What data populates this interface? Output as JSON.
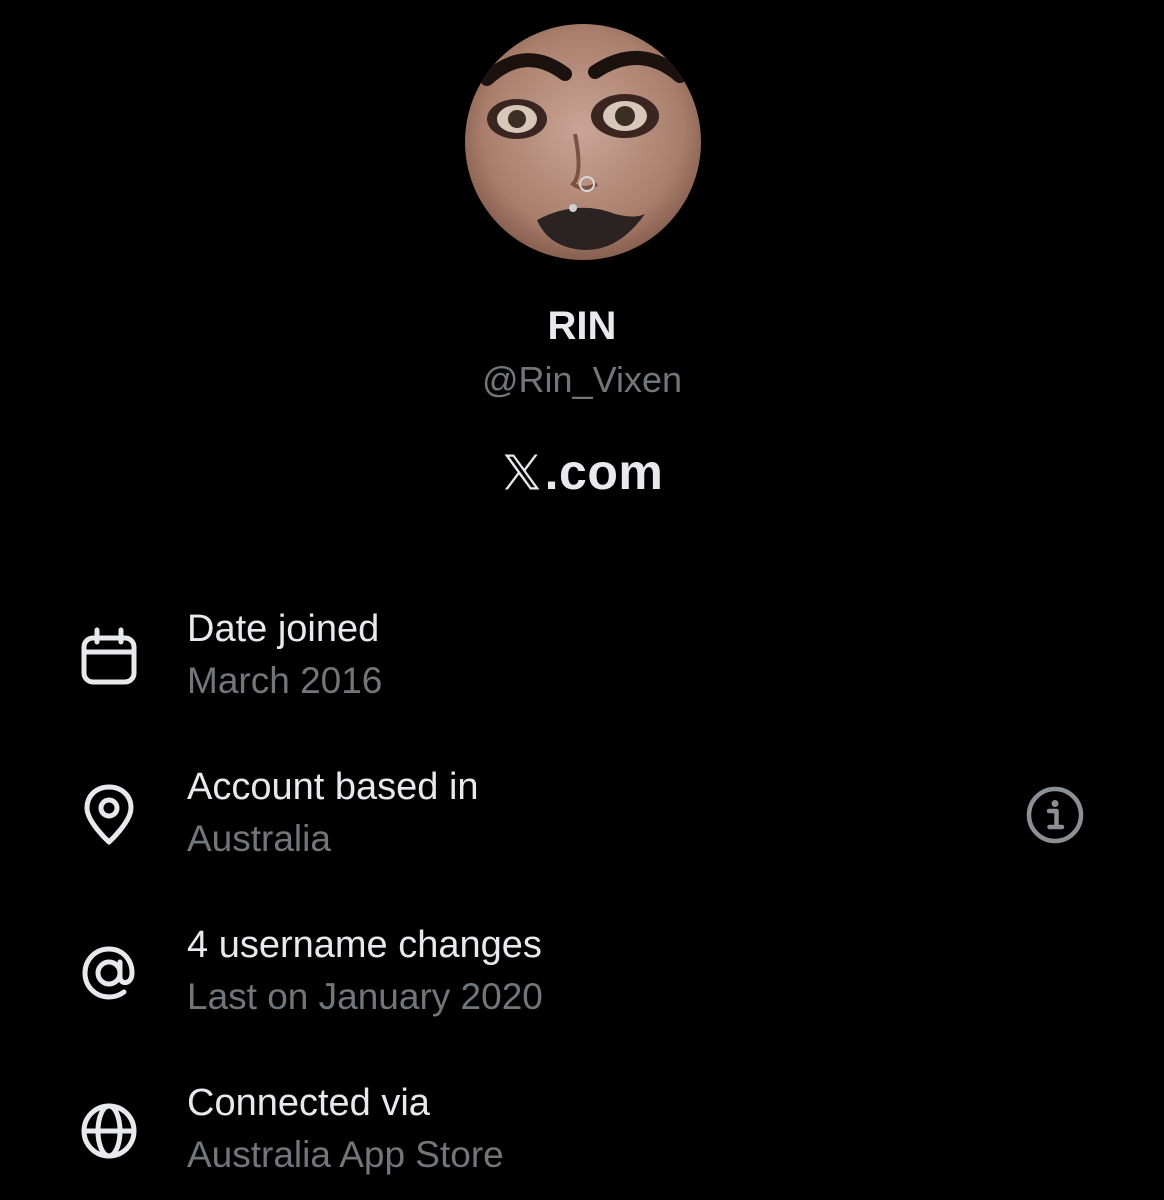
{
  "profile": {
    "display_name": "RIN",
    "handle": "@Rin_Vixen",
    "avatar": "profile-photo"
  },
  "brand": {
    "logo_icon": "x-logo-icon",
    "text": ".com"
  },
  "details": [
    {
      "icon": "calendar-icon",
      "title": "Date joined",
      "subtitle": "March 2016"
    },
    {
      "icon": "location-pin-icon",
      "title": "Account based in",
      "subtitle": "Australia",
      "action_icon": "info-icon"
    },
    {
      "icon": "at-sign-icon",
      "title": "4 username changes",
      "subtitle": "Last on January 2020"
    },
    {
      "icon": "globe-icon",
      "title": "Connected via",
      "subtitle": "Australia App Store"
    }
  ],
  "colors": {
    "background": "#000000",
    "primary_text": "#e7e9ea",
    "secondary_text": "#71767b"
  }
}
